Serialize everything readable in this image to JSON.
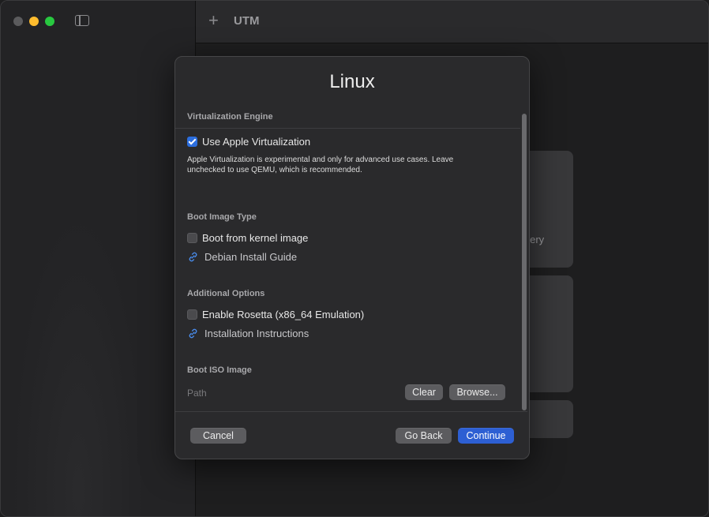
{
  "window": {
    "app_title": "UTM"
  },
  "background_tiles": {
    "tile1_label": "Gallery"
  },
  "dialog": {
    "title": "Linux",
    "virtualization": {
      "section_title": "Virtualization Engine",
      "checkbox_label": "Use Apple Virtualization",
      "checked": true,
      "help_text": "Apple Virtualization is experimental and only for advanced use cases. Leave unchecked to use QEMU, which is recommended."
    },
    "boot_image": {
      "section_title": "Boot Image Type",
      "checkbox_label": "Boot from kernel image",
      "checked": false,
      "link_label": "Debian Install Guide"
    },
    "additional": {
      "section_title": "Additional Options",
      "checkbox_label": "Enable Rosetta (x86_64 Emulation)",
      "checked": false,
      "link_label": "Installation Instructions"
    },
    "boot_iso": {
      "section_title": "Boot ISO Image",
      "path_placeholder": "Path",
      "clear_label": "Clear",
      "browse_label": "Browse..."
    },
    "footer": {
      "cancel_label": "Cancel",
      "back_label": "Go Back",
      "continue_label": "Continue"
    }
  },
  "colors": {
    "accent": "#2d5fd3",
    "link": "#4a8ef0"
  }
}
